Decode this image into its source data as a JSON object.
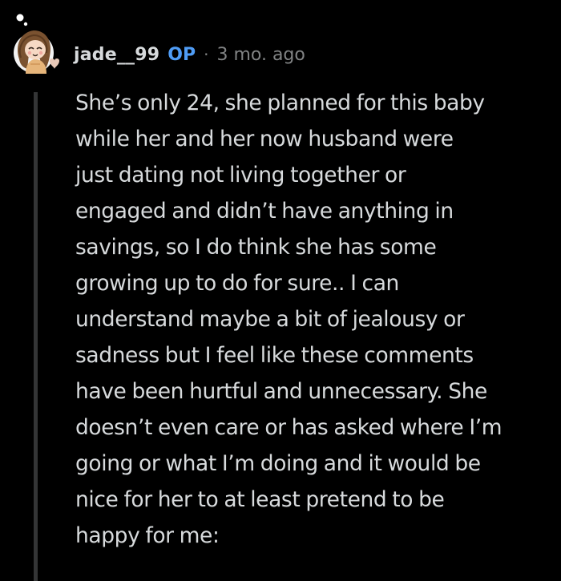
{
  "comment": {
    "author": {
      "username": "jade__99",
      "badge": "OP",
      "avatar_icon": "user-avatar-icon"
    },
    "separator": "·",
    "timestamp": "3 mo. ago",
    "body_lines": [
      "She’s only 24, she planned for this baby",
      "while her and her now husband were",
      "just dating not living together or",
      "engaged and didn’t have anything in",
      "savings, so I do think she has some",
      "growing up to do for sure.. I can",
      "understand maybe a bit of jealousy or",
      "sadness but I feel like these comments",
      "have been hurtful and unnecessary. She",
      "doesn’t even care or has asked where I’m",
      "going or what I’m doing and it would be",
      "nice for her to at least pretend to be",
      "happy for me:"
    ]
  },
  "colors": {
    "background": "#000000",
    "text": "#d7dadc",
    "meta": "#818384",
    "op": "#4f9cf5",
    "thread_line": "#343536"
  }
}
